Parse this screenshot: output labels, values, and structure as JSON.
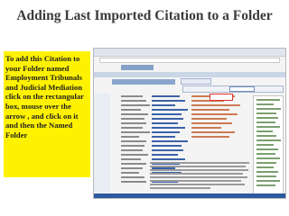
{
  "slide": {
    "title": "Adding Last Imported Citation to a Folder",
    "instruction": "To add this Citation to your Folder named Employment Tribunals and Judicial Mediation click on the rectangular box, mouse  over the arrow , and click on it and then the Named Folder"
  },
  "colors": {
    "instruction_background": "#fff200",
    "title_text": "#3a3a3a"
  }
}
